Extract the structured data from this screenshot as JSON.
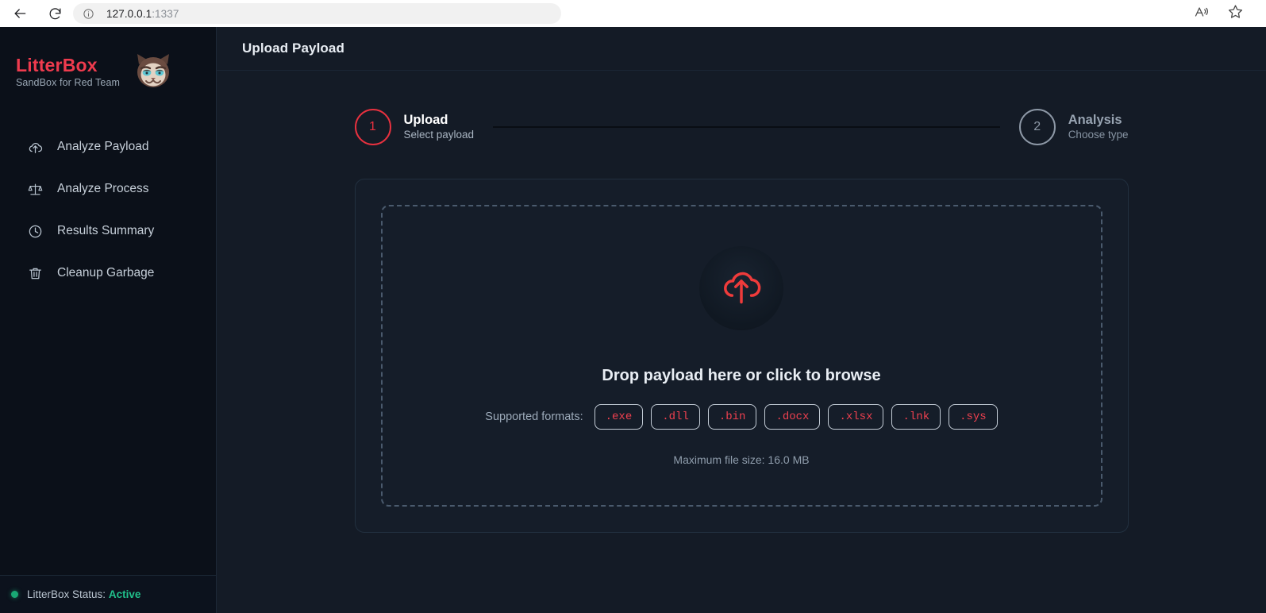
{
  "browser": {
    "back_icon": "back-arrow-icon",
    "reload_icon": "reload-icon",
    "info_icon": "site-info-icon",
    "url_host": "127.0.0.1",
    "url_port": ":1337",
    "read_aloud_icon": "read-aloud-icon",
    "favorite_icon": "favorite-star-icon"
  },
  "sidebar": {
    "brand": {
      "title": "LitterBox",
      "subtitle": "SandBox for Red Team",
      "logo": "grumpy-cat-logo",
      "title_color": "#ef3b4e"
    },
    "items": [
      {
        "label": "Analyze Payload",
        "icon": "upload-cloud-icon"
      },
      {
        "label": "Analyze Process",
        "icon": "scales-icon"
      },
      {
        "label": "Results Summary",
        "icon": "clock-icon"
      },
      {
        "label": "Cleanup Garbage",
        "icon": "trash-icon"
      }
    ],
    "status": {
      "label": "LitterBox Status:",
      "value": "Active",
      "dot_color": "#19a974",
      "value_color": "#21c08b"
    }
  },
  "header": {
    "title": "Upload Payload"
  },
  "stepper": {
    "steps": [
      {
        "number": "1",
        "name": "Upload",
        "desc": "Select payload",
        "state": "active"
      },
      {
        "number": "2",
        "name": "Analysis",
        "desc": "Choose type",
        "state": "inactive"
      }
    ],
    "active_color": "#e8313f",
    "inactive_color": "#8d98a6"
  },
  "upload": {
    "icon": "upload-cloud-icon",
    "icon_color": "#ef3b3b",
    "drop_title": "Drop payload here or click to browse",
    "formats_label": "Supported formats:",
    "formats": [
      ".exe",
      ".dll",
      ".bin",
      ".docx",
      ".xlsx",
      ".lnk",
      ".sys"
    ],
    "max_size": "Maximum file size: 16.0 MB"
  }
}
